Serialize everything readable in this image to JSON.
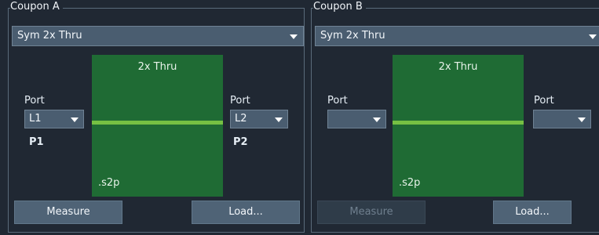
{
  "coupon_a": {
    "title": "Coupon A",
    "type_select": "Sym 2x Thru",
    "thru_title": "2x Thru",
    "file_ext": ".s2p",
    "left_port": {
      "label": "Port",
      "value": "L1",
      "pnum": "P1"
    },
    "right_port": {
      "label": "Port",
      "value": "L2",
      "pnum": "P2"
    },
    "measure_label": "Measure",
    "load_label": "Load..."
  },
  "coupon_b": {
    "title": "Coupon B",
    "type_select": "Sym 2x Thru",
    "thru_title": "2x Thru",
    "file_ext": ".s2p",
    "left_port": {
      "label": "Port",
      "value": ""
    },
    "right_port": {
      "label": "Port",
      "value": ""
    },
    "measure_label": "Measure",
    "load_label": "Load..."
  }
}
